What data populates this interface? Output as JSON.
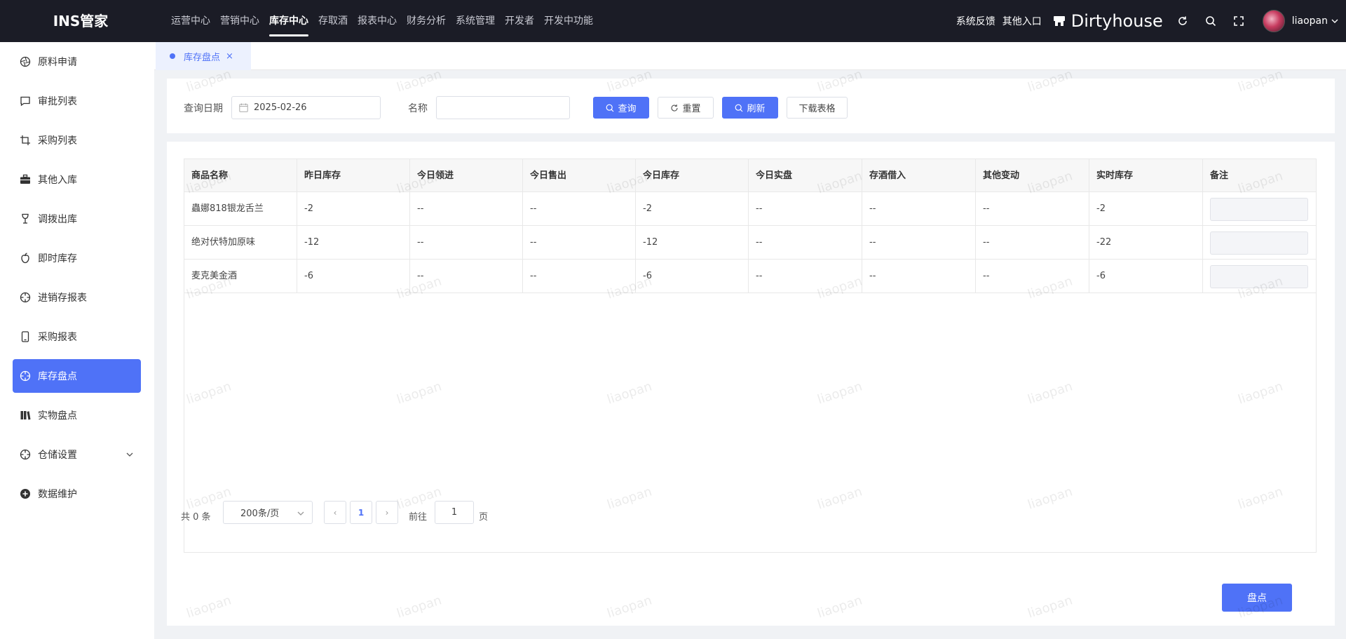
{
  "app": {
    "logo": "INS管家"
  },
  "topnav": {
    "items": [
      "运营中心",
      "营销中心",
      "库存中心",
      "存取酒",
      "报表中心",
      "财务分析",
      "系统管理",
      "开发者",
      "开发中功能"
    ],
    "active_index": 2
  },
  "header": {
    "feedback": "系统反馈",
    "other_entry": "其他入口",
    "store_name": "Dirtyhouse",
    "username": "liaopan"
  },
  "sidebar": {
    "items": [
      {
        "label": "原料申请",
        "icon": "aperture-icon"
      },
      {
        "label": "审批列表",
        "icon": "chat-icon"
      },
      {
        "label": "采购列表",
        "icon": "crop-icon"
      },
      {
        "label": "其他入库",
        "icon": "briefcase-icon"
      },
      {
        "label": "调拨出库",
        "icon": "goblet-icon"
      },
      {
        "label": "即时库存",
        "icon": "apple-icon"
      },
      {
        "label": "进销存报表",
        "icon": "crosshair-icon"
      },
      {
        "label": "采购报表",
        "icon": "phone-icon"
      },
      {
        "label": "库存盘点",
        "icon": "crosshair-icon"
      },
      {
        "label": "实物盘点",
        "icon": "books-icon"
      },
      {
        "label": "仓储设置",
        "icon": "crosshair-icon"
      },
      {
        "label": "数据维护",
        "icon": "plus-circle-icon"
      }
    ],
    "active_index": 8
  },
  "tabs": [
    {
      "label": "库存盘点",
      "close": "×"
    }
  ],
  "filter": {
    "date_label": "查询日期",
    "date_value": "2025-02-26",
    "name_label": "名称",
    "name_value": "",
    "query_btn": "查询",
    "reset_btn": "重置",
    "refresh_btn": "刷新",
    "download_btn": "下载表格"
  },
  "table": {
    "columns": [
      "商品名称",
      "昨日库存",
      "今日领进",
      "今日售出",
      "今日库存",
      "今日实盘",
      "存酒借入",
      "其他变动",
      "实时库存",
      "备注"
    ],
    "rows": [
      [
        "蟲娜818银龙舌兰",
        "-2",
        "--",
        "--",
        "-2",
        "--",
        "--",
        "--",
        "-2"
      ],
      [
        "绝对伏特加原味",
        "-12",
        "--",
        "--",
        "-12",
        "--",
        "--",
        "--",
        "-22"
      ],
      [
        "麦克美金酒",
        "-6",
        "--",
        "--",
        "-6",
        "--",
        "--",
        "--",
        "-6"
      ]
    ]
  },
  "pagination": {
    "total": "共 0 条",
    "page_size": "200条/页",
    "prev": "‹",
    "current": "1",
    "next": "›",
    "goto_label": "前往",
    "goto_value": "1",
    "page_suffix": "页"
  },
  "actions": {
    "count_btn": "盘点"
  },
  "watermark": "liaopan",
  "colors": {
    "accent": "#4f72f7",
    "topbar": "#1b1c26"
  }
}
